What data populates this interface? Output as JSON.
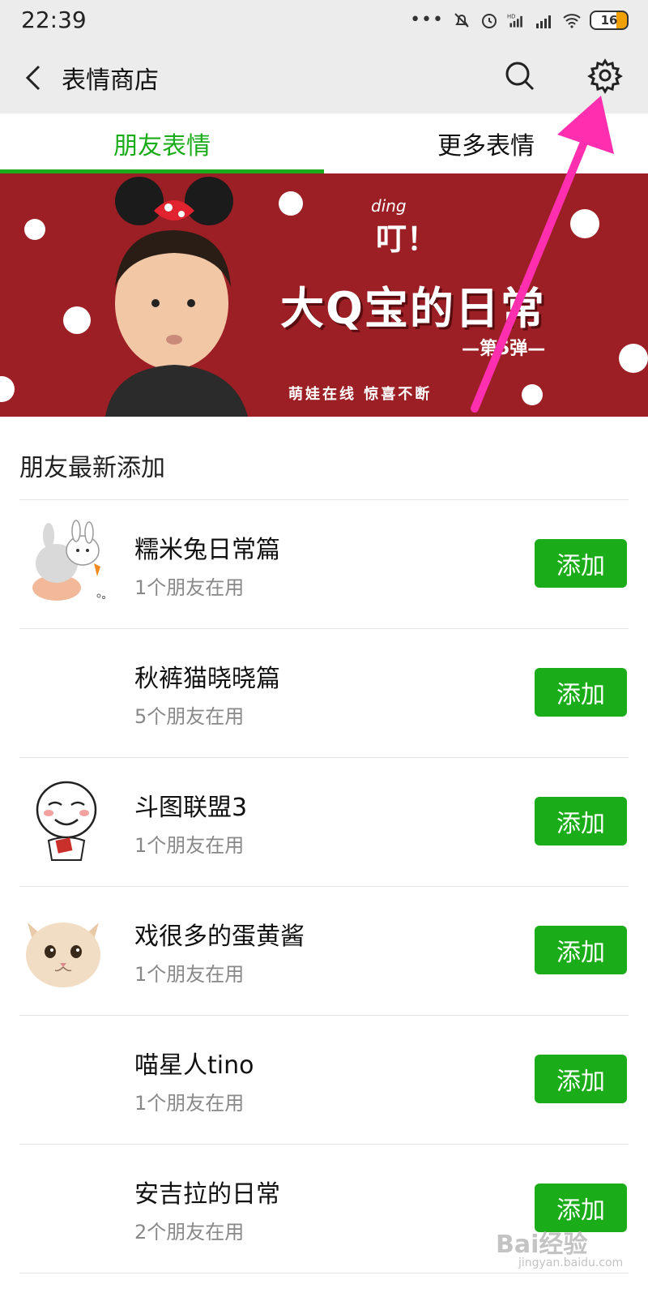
{
  "status_bar": {
    "time": "22:39",
    "dots": "•••",
    "battery": "16",
    "hd": "HD"
  },
  "header": {
    "title": "表情商店"
  },
  "tabs": [
    {
      "label": "朋友表情",
      "active": true
    },
    {
      "label": "更多表情",
      "active": false
    }
  ],
  "banner": {
    "ding": "ding",
    "ke": "叮！",
    "title": "大Q宝的日常",
    "subtitle": "—第5弹—",
    "tagline": "萌娃在线 惊喜不断"
  },
  "section": {
    "title": "朋友最新添加"
  },
  "items": [
    {
      "name": "糯米兔日常篇",
      "sub": "1个朋友在用",
      "button": "添加",
      "thumb": "rabbit-sticker-icon"
    },
    {
      "name": "秋裤猫晓晓篇",
      "sub": "5个朋友在用",
      "button": "添加",
      "thumb": ""
    },
    {
      "name": "斗图联盟3",
      "sub": "1个朋友在用",
      "button": "添加",
      "thumb": "meme-face-sticker-icon"
    },
    {
      "name": "戏很多的蛋黄酱",
      "sub": "1个朋友在用",
      "button": "添加",
      "thumb": "cat-face-sticker-icon"
    },
    {
      "name": "喵星人tino",
      "sub": "1个朋友在用",
      "button": "添加",
      "thumb": ""
    },
    {
      "name": "安吉拉的日常",
      "sub": "2个朋友在用",
      "button": "添加",
      "thumb": ""
    }
  ],
  "watermark": {
    "text": "Bai经验",
    "sub": "jingyan.baidu.com"
  },
  "colors": {
    "accent": "#1aad19",
    "banner_bg": "#9b1f24",
    "annotation": "#ff2fb0"
  }
}
